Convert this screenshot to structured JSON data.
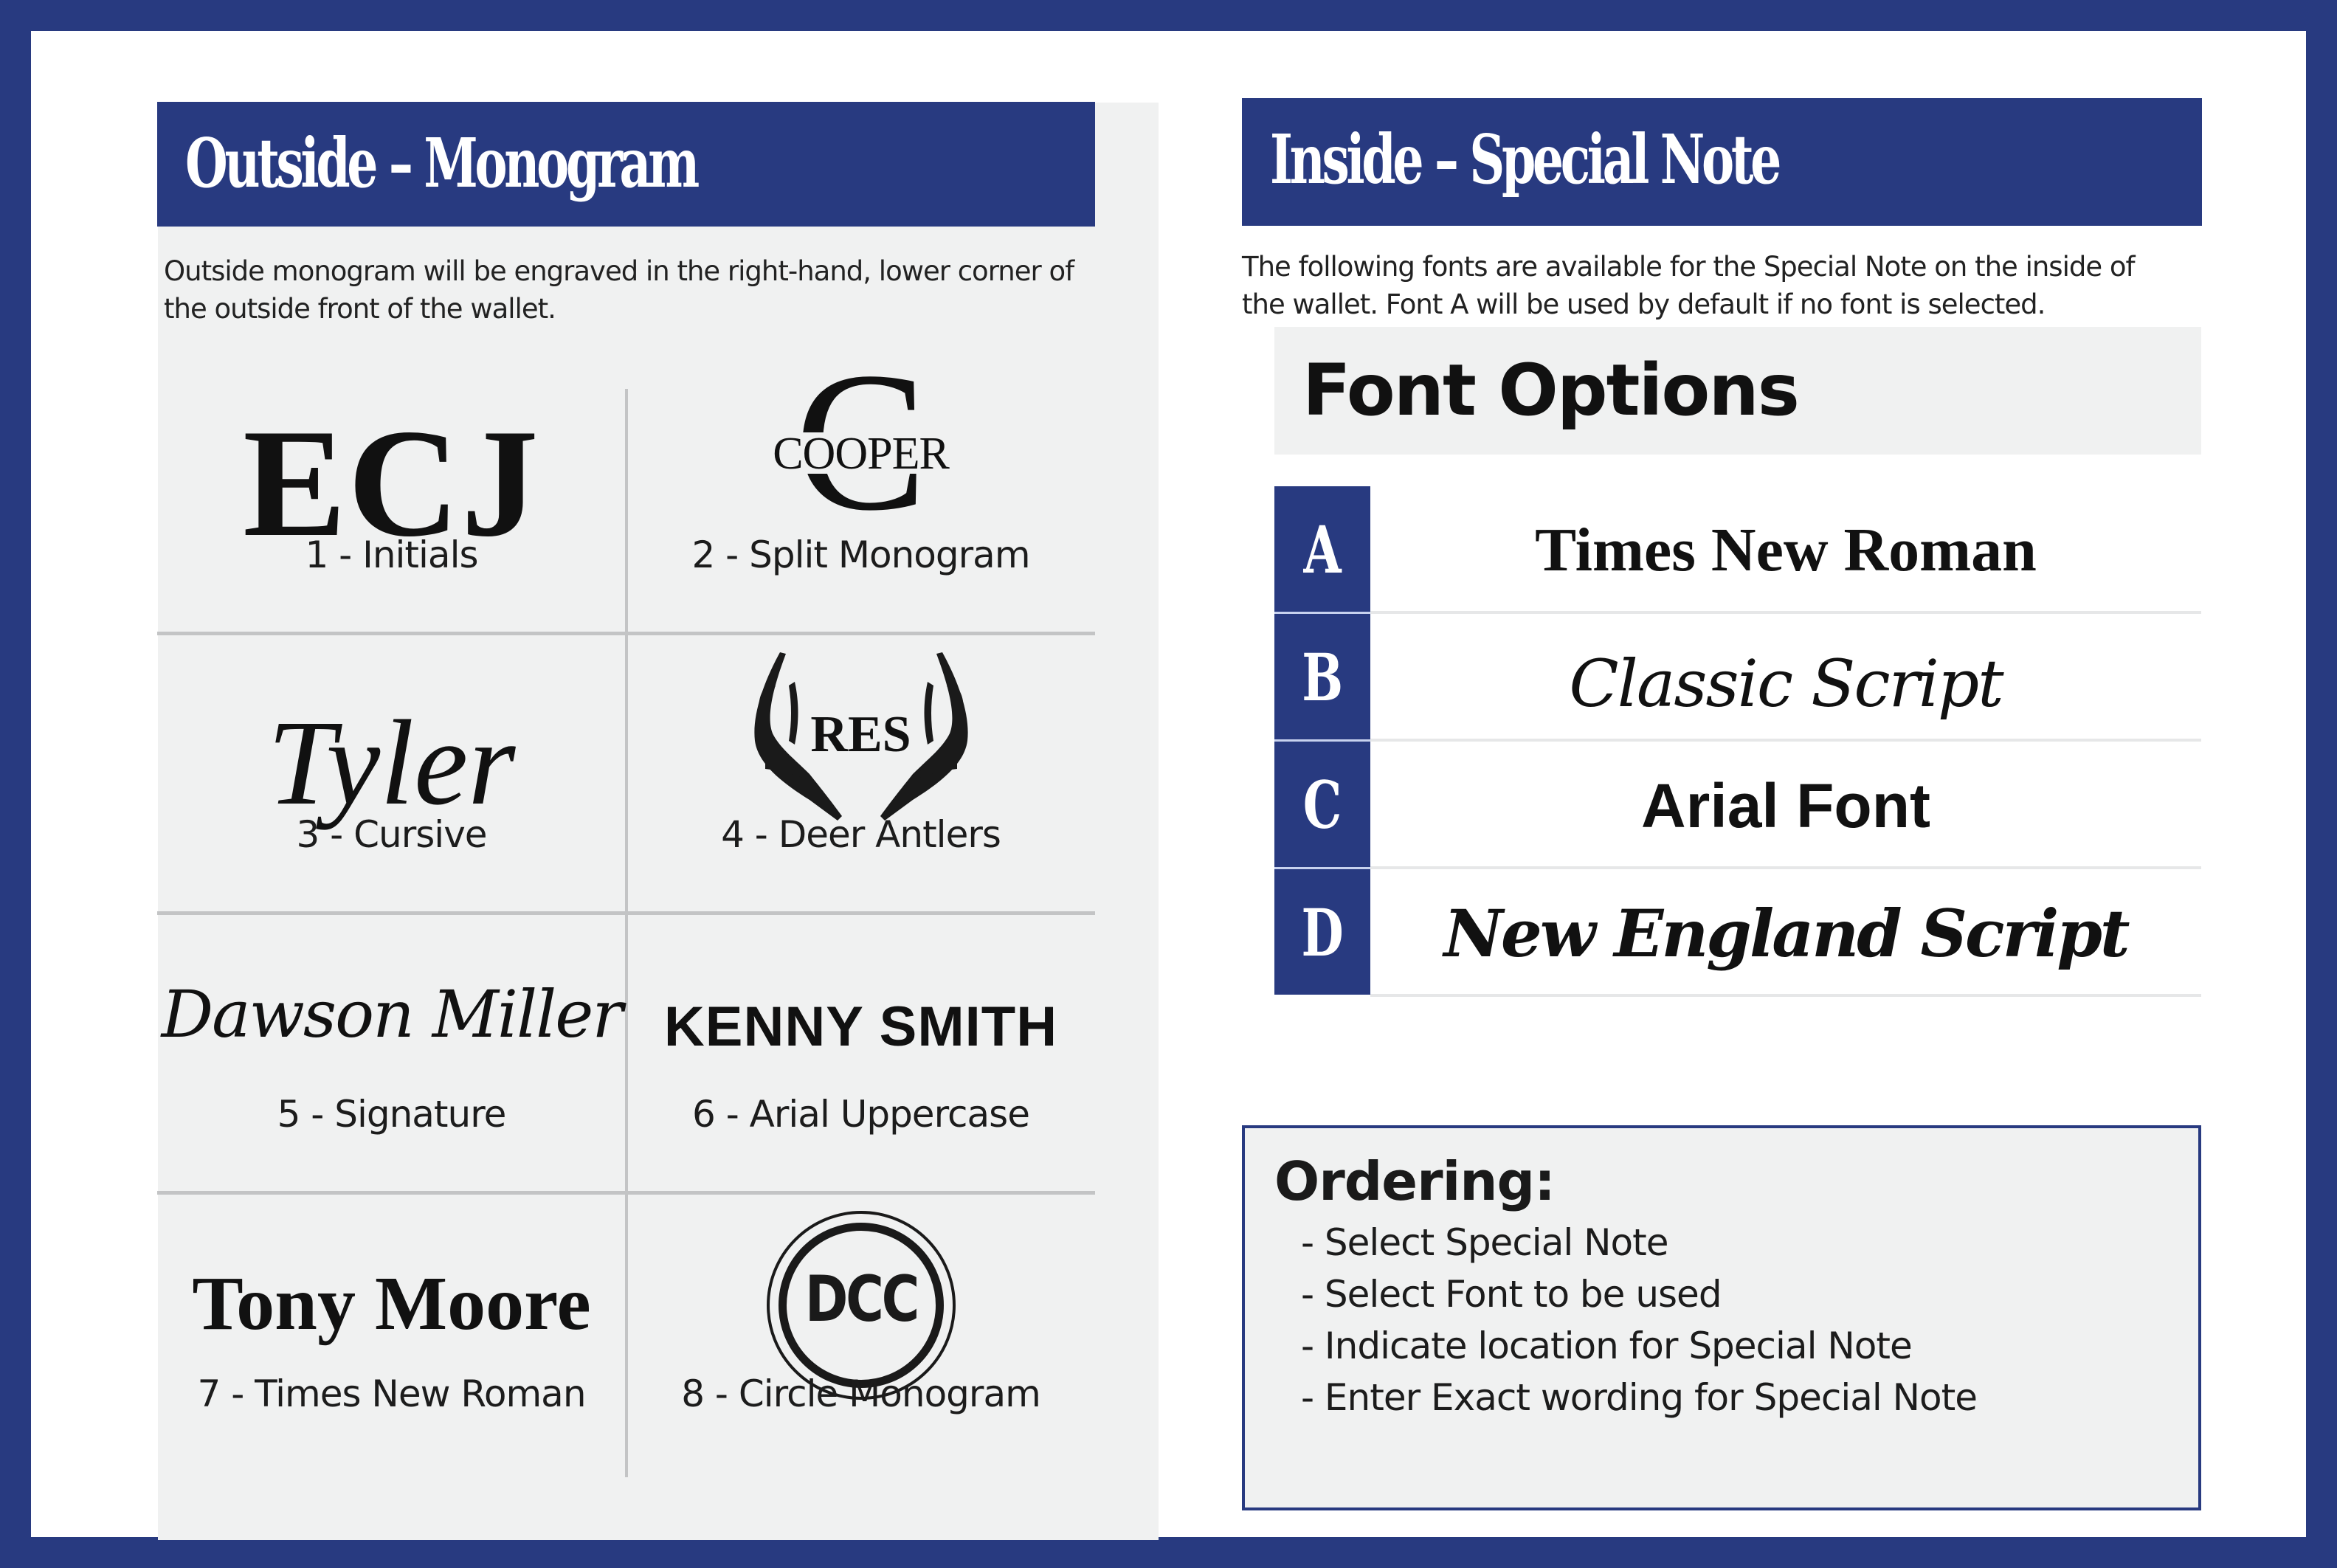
{
  "colors": {
    "brand_navy": "#283a80",
    "panel_gray": "#f0f1f1",
    "divider_gray": "#c3c4c5"
  },
  "outside": {
    "title": "Outside – Monogram",
    "description_lines": [
      "Outside monogram will be engraved in the right-hand, lower corner of",
      "the outside front of the wallet."
    ],
    "styles": [
      {
        "number": 1,
        "label": "1 - Initials",
        "sample": "ECJ"
      },
      {
        "number": 2,
        "label": "2 - Split Monogram",
        "sample_letter": "C",
        "sample": "COOPER"
      },
      {
        "number": 3,
        "label": "3 - Cursive",
        "sample": "Tyler"
      },
      {
        "number": 4,
        "label": "4 - Deer Antlers",
        "sample": "RES",
        "icon": "deer-antlers-icon"
      },
      {
        "number": 5,
        "label": "5 - Signature",
        "sample": "Dawson Miller"
      },
      {
        "number": 6,
        "label": "6 - Arial Uppercase",
        "sample": "KENNY SMITH"
      },
      {
        "number": 7,
        "label": "7 - Times New Roman",
        "sample": "Tony Moore"
      },
      {
        "number": 8,
        "label": "8 - Circle Monogram",
        "sample": "DCC",
        "icon": "double-circle-icon"
      }
    ]
  },
  "inside": {
    "title": "Inside – Special Note",
    "description_lines": [
      "The following fonts are available for the Special Note on the inside of",
      "the wallet.  Font A will be used by default if no font is selected."
    ],
    "font_options_title": "Font Options",
    "fonts": [
      {
        "letter": "A",
        "name": "Times New Roman"
      },
      {
        "letter": "B",
        "name": "Classic Script"
      },
      {
        "letter": "C",
        "name": "Arial Font"
      },
      {
        "letter": "D",
        "name": "New England Script"
      }
    ]
  },
  "ordering": {
    "title": "Ordering:",
    "steps": [
      "- Select Special Note",
      "- Select Font to be used",
      "- Indicate location for Special Note",
      "- Enter Exact wording for Special Note"
    ]
  }
}
